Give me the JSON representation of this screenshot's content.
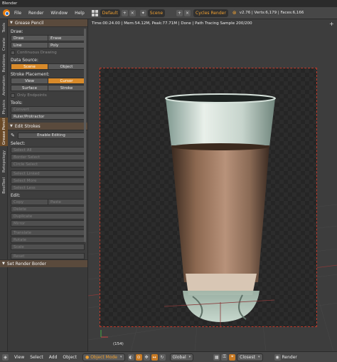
{
  "window": {
    "title": "Blender"
  },
  "menubar": {
    "items": [
      "File",
      "Render",
      "Window",
      "Help"
    ],
    "screen_layout": "Default",
    "scene": "Scene",
    "render_engine": "Cycles Render",
    "stats": "v2.76 | Verts:6,179 | Faces:6,166"
  },
  "toolbar_tabs": [
    "Tools",
    "Create",
    "Relations",
    "Animation",
    "Physics",
    "Grease Pencil",
    "Retopology",
    "BoolTool"
  ],
  "grease_pencil": {
    "title": "Grease Pencil",
    "draw_label": "Draw:",
    "draw": "Draw",
    "erase": "Erase",
    "line": "Line",
    "poly": "Poly",
    "continuous": "Continuous Drawing",
    "data_source_label": "Data Source:",
    "scene_btn": "Scene",
    "object_btn": "Object",
    "placement_label": "Stroke Placement:",
    "view": "View",
    "cursor": "Cursor",
    "surface": "Surface",
    "stroke": "Stroke",
    "only_endpoints": "Only Endpoints",
    "tools_label": "Tools:",
    "convert": "Convert",
    "ruler": "Ruler/Protractor"
  },
  "edit_strokes": {
    "title": "Edit Strokes",
    "enable_editing": "Enable Editing",
    "select_label": "Select:",
    "select_all": "Select All",
    "border_select": "Border Select",
    "circle_select": "Circle Select",
    "select_linked": "Select Linked",
    "select_more": "Select More",
    "select_less": "Select Less",
    "edit_label": "Edit:",
    "copy": "Copy",
    "paste": "Paste",
    "delete": "Delete",
    "duplicate": "Duplicate",
    "mirror": "Mirror",
    "translate": "Translate",
    "rotate": "Rotate",
    "scale": "Scale",
    "reset": "Reset"
  },
  "operator_panel": {
    "title": "Set Render Border"
  },
  "viewport": {
    "info": "Time:00:24.00 | Mem:54.12M, Peak:77.71M | Done | Path Tracing Sample 200/200",
    "frame": "(154)"
  },
  "bottombar": {
    "menus": [
      "View",
      "Select",
      "Add",
      "Object"
    ],
    "mode": "Object Mode",
    "pivot": "Global",
    "snap": "Closest",
    "right_label": "Render"
  },
  "colors": {
    "accent": "#d88a2a",
    "panel_header": "#5a4a3c",
    "border_dashed": "#c23a2a"
  }
}
